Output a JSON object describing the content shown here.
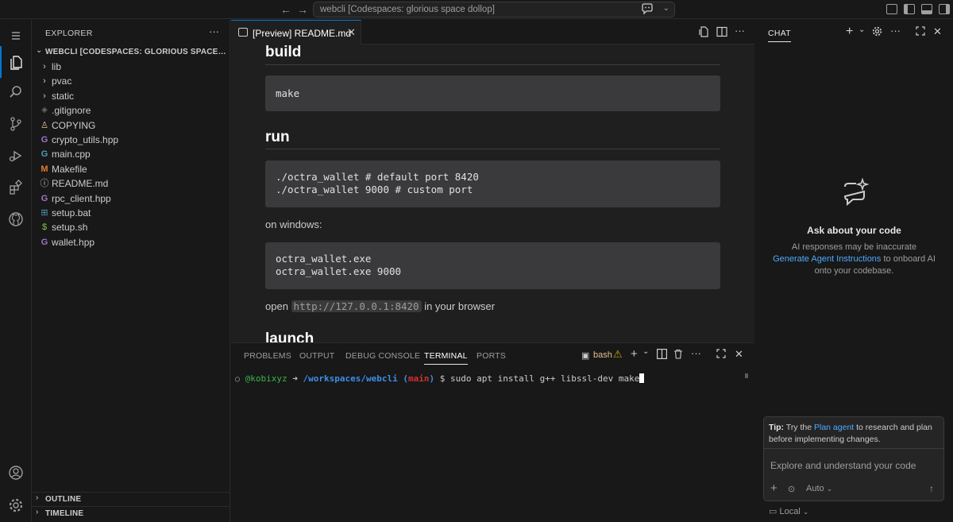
{
  "titlebar": {
    "search_text": "webcli [Codespaces: glorious space dollop]"
  },
  "sidebar": {
    "title": "EXPLORER",
    "folder": "WEBCLI [CODESPACES: GLORIOUS SPACE DOLLOP]",
    "items": [
      {
        "label": "lib",
        "icon": "chevron-right-icon",
        "type": "folder"
      },
      {
        "label": "pvac",
        "icon": "chevron-right-icon",
        "type": "folder"
      },
      {
        "label": "static",
        "icon": "chevron-right-icon",
        "type": "folder"
      },
      {
        "label": ".gitignore",
        "icon": "git-icon",
        "type": "file"
      },
      {
        "label": "COPYING",
        "icon": "license-icon",
        "type": "file"
      },
      {
        "label": "crypto_utils.hpp",
        "icon": "cpp-icon",
        "type": "file"
      },
      {
        "label": "main.cpp",
        "icon": "cpp-icon",
        "type": "file"
      },
      {
        "label": "Makefile",
        "icon": "makefile-icon",
        "type": "file"
      },
      {
        "label": "README.md",
        "icon": "info-icon",
        "type": "file"
      },
      {
        "label": "rpc_client.hpp",
        "icon": "cpp-icon",
        "type": "file"
      },
      {
        "label": "setup.bat",
        "icon": "windows-icon",
        "type": "file"
      },
      {
        "label": "setup.sh",
        "icon": "dollar-icon",
        "type": "file"
      },
      {
        "label": "wallet.hpp",
        "icon": "cpp-icon",
        "type": "file"
      }
    ],
    "outline": "OUTLINE",
    "timeline": "TIMELINE"
  },
  "editor": {
    "tab_label": "[Preview] README.md",
    "content": {
      "h_build": "build",
      "code_build": "make",
      "h_run": "run",
      "code_run_1": "./octra_wallet # default port 8420",
      "code_run_2": "./octra_wallet 9000 # custom port",
      "p_windows": "on windows:",
      "code_win_1": "octra_wallet.exe",
      "code_win_2": "octra_wallet.exe 9000",
      "p_open_before": "open ",
      "p_open_code": "http://127.0.0.1:8420",
      "p_open_after": " in your browser",
      "h_launch": "launch"
    }
  },
  "panel": {
    "tabs": [
      "PROBLEMS",
      "OUTPUT",
      "DEBUG CONSOLE",
      "TERMINAL",
      "PORTS"
    ],
    "active_tab": "TERMINAL",
    "shell": "bash",
    "terminal": {
      "user": "@kobixyz",
      "arrow": "➜",
      "path": "/workspaces/webcli",
      "branch_open": "(",
      "branch": "main",
      "branch_close": ")",
      "prompt": "$",
      "command": "sudo apt install g++ libssl-dev make"
    }
  },
  "chat": {
    "title": "CHAT",
    "heading": "Ask about your code",
    "desc_1": "AI responses may be inaccurate",
    "desc_link": "Generate Agent Instructions",
    "desc_2": " to onboard AI onto your codebase.",
    "tip_label": "Tip:",
    "tip_before": " Try the ",
    "tip_link": "Plan agent",
    "tip_after": " to research and plan before implementing changes.",
    "input_placeholder": "Explore and understand your code",
    "mode": "Auto",
    "location": "Local"
  },
  "colors": {
    "accent": "#0078d4",
    "link": "#4daafc",
    "terminal_user": "#39b54a",
    "terminal_path": "#3b8eea",
    "terminal_branch": "#cd3131"
  }
}
